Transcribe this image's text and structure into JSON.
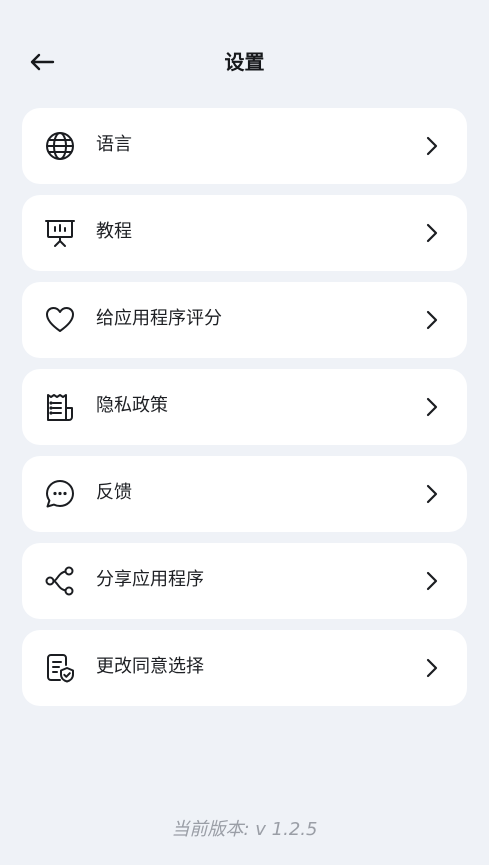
{
  "header": {
    "title": "设置",
    "back_icon": "arrow-left-icon"
  },
  "menu": {
    "items": [
      {
        "label": "语言",
        "icon": "globe-icon"
      },
      {
        "label": "教程",
        "icon": "presentation-board-icon"
      },
      {
        "label": "给应用程序评分",
        "icon": "heart-icon"
      },
      {
        "label": "隐私政策",
        "icon": "receipt-document-icon"
      },
      {
        "label": "反馈",
        "icon": "chat-bubble-icon"
      },
      {
        "label": "分享应用程序",
        "icon": "share-nodes-icon"
      },
      {
        "label": "更改同意选择",
        "icon": "document-shield-icon"
      }
    ],
    "chevron_icon": "chevron-right-icon"
  },
  "footer": {
    "version_text": "当前版本: v 1.2.5"
  },
  "colors": {
    "background": "#EFF2F7",
    "card": "#FFFFFF",
    "text": "#1E2024",
    "version_text": "#9A9EA6"
  }
}
